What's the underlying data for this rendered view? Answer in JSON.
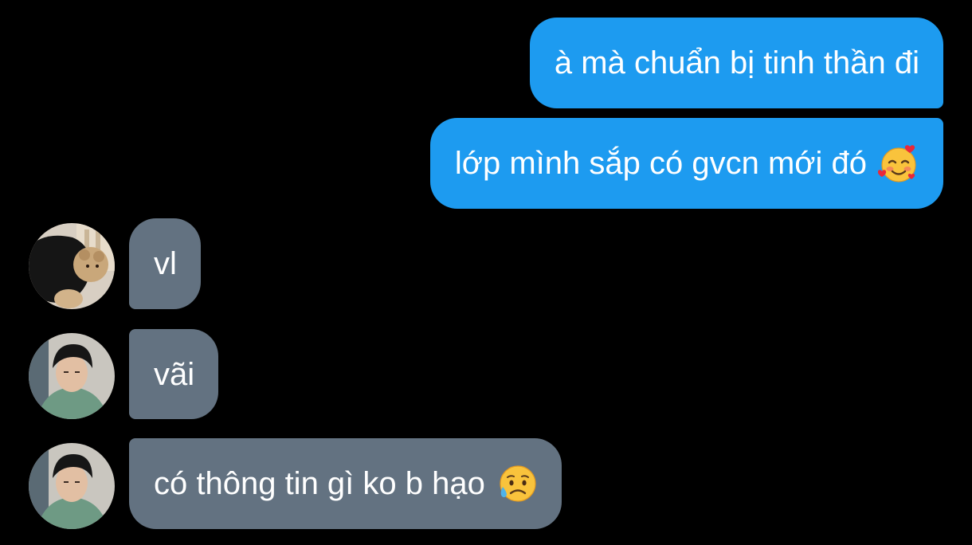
{
  "conversation": {
    "messages": [
      {
        "side": "outgoing",
        "text": "à mà chuẩn bị tinh thần đi",
        "emoji": null
      },
      {
        "side": "outgoing",
        "text": "lớp mình sắp có gvcn mới đó",
        "emoji": "smiling-face-with-hearts-icon"
      },
      {
        "side": "incoming",
        "text": "vl",
        "emoji": null
      },
      {
        "side": "incoming",
        "text": "vãi",
        "emoji": null
      },
      {
        "side": "incoming",
        "text": "có thông tin gì ko b hạo",
        "emoji": "sad-but-relieved-face-icon"
      }
    ]
  },
  "colors": {
    "background": "#000000",
    "outgoing_bubble": "#1d9bf0",
    "incoming_bubble": "#637281",
    "text": "#ffffff"
  }
}
